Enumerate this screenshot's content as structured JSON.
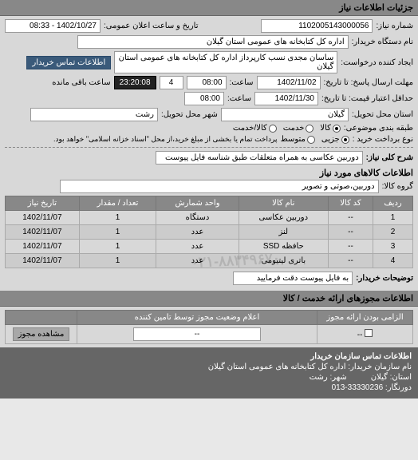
{
  "headers": {
    "main": "جزئیات اطلاعات نیاز",
    "goods": "اطلاعات کالاهای مورد نیاز",
    "license": "اطلاعات مجوزهای ارائه خدمت / کالا",
    "contact": "اطلاعات تماس سازمان خریدار"
  },
  "info": {
    "req_no_label": "شماره نیاز:",
    "req_no": "1102005143000056",
    "announce_label": "تاریخ و ساعت اعلان عمومی:",
    "announce": "1402/10/27 - 08:33",
    "buyer_label": "نام دستگاه خریدار:",
    "buyer": "اداره کل کتابخانه های عمومی استان گیلان",
    "requester_label": "ایجاد کننده درخواست:",
    "requester": "ساسان مجدی نسب کارپرداز اداره کل کتابخانه های عمومی استان گیلان",
    "contact_btn": "اطلاعات تماس خریدار",
    "deadline_reply_label": "مهلت ارسال پاسخ: تا تاریخ:",
    "deadline_reply_date": "1402/11/02",
    "time_label": "ساعت:",
    "deadline_reply_time": "08:00",
    "days_left": "4",
    "remaining_label": "ساعت باقی مانده",
    "timer": "23:20:08",
    "deadline_price_label": "حداقل اعتبار قیمت: تا تاریخ:",
    "deadline_price_date": "1402/11/30",
    "deadline_price_time": "08:00",
    "province_label": "استان محل تحویل:",
    "province": "گیلان",
    "city_label": "شهر محل تحویل:",
    "city": "رشت",
    "categorize_label": "طبقه بندی موضوعی:",
    "pay_method_label": "نوع برداخت خرید :",
    "pay_method_value": "پرداخت تمام یا بخشی از مبلغ خرید،از محل \"اسناد خزانه اسلامی\" خواهد بود.",
    "desc_label": "شرح کلی نیاز:",
    "desc": "دوربین عکاسی به همراه متعلقات طبق شناسه فایل پیوست",
    "group_label": "گروه کالا:",
    "group_value": "دوربین،صوتی و تصویر",
    "buyer_note_label": "توضیحات خریدار:",
    "buyer_note": "به فایل پیوست دقت فرمایید"
  },
  "category_radios": {
    "goods": "کالا",
    "service": "خدمت",
    "both": "کالا/خدمت"
  },
  "quality_radios": {
    "low": "جزیی",
    "mid": "متوسط"
  },
  "goods_table": {
    "cols": [
      "ردیف",
      "کد کالا",
      "نام کالا",
      "واحد شمارش",
      "تعداد / مقدار",
      "تاریخ نیاز"
    ],
    "rows": [
      [
        "1",
        "--",
        "دوربین عکاسی",
        "دستگاه",
        "1",
        "1402/11/07"
      ],
      [
        "2",
        "--",
        "لنز",
        "عدد",
        "1",
        "1402/11/07"
      ],
      [
        "3",
        "--",
        "حافظه SSD",
        "عدد",
        "1",
        "1402/11/07"
      ],
      [
        "4",
        "--",
        "باتری لیتیومی",
        "عدد",
        "1",
        "1402/11/07"
      ]
    ]
  },
  "watermark": "۰۲۱-۸۸۳۴۹۶۷۰",
  "license_table": {
    "cols": [
      "الزامی بودن ارائه مجوز",
      "اعلام وضعیت مجوز توسط تامین کننده",
      ""
    ],
    "row": [
      "--",
      "--",
      ""
    ],
    "view_btn": "مشاهده مجوز"
  },
  "contact": {
    "org_label": "نام سازمان خریدار:",
    "org": "اداره کل کتابخانه های عمومی استان گیلان",
    "province_label": "استان:",
    "province": "گیلان",
    "fax_label": "دورنگار:",
    "fax": "33330236-013",
    "city_label": "شهر:",
    "city": "رشت"
  }
}
